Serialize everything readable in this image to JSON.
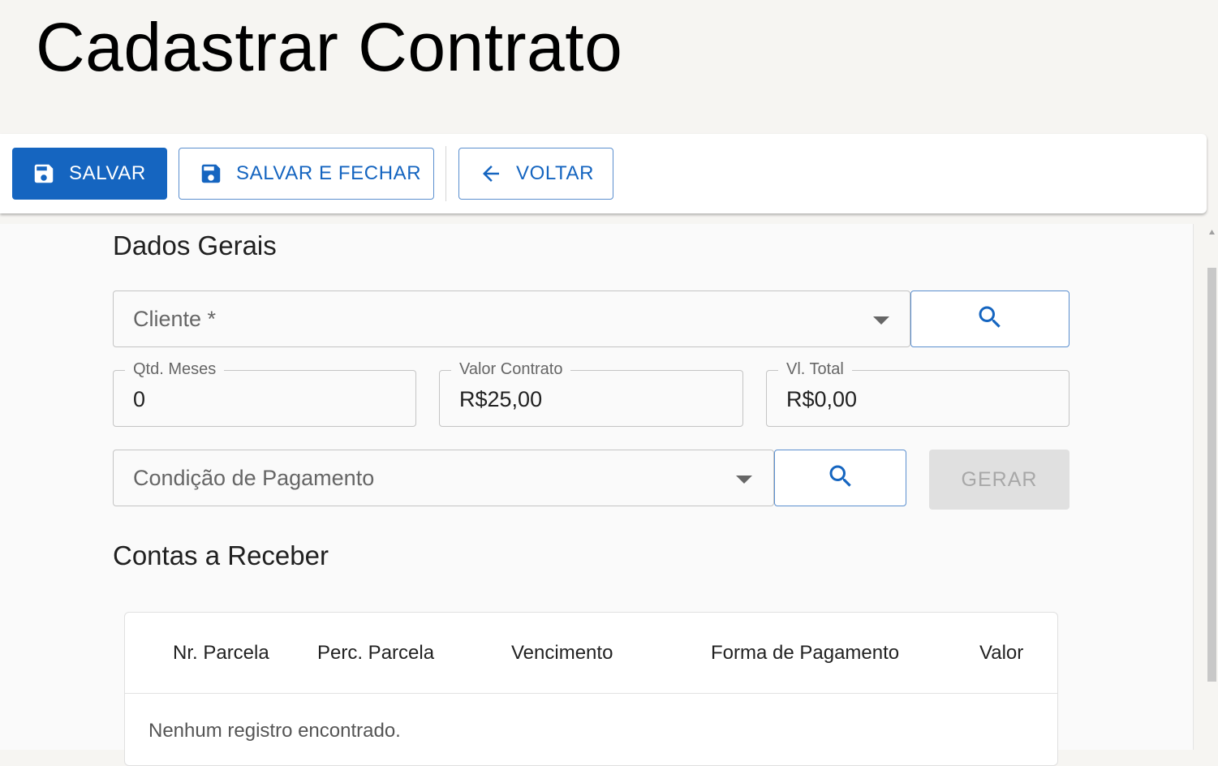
{
  "page": {
    "title": "Cadastrar Contrato"
  },
  "toolbar": {
    "save_label": "SALVAR",
    "save_close_label": "SALVAR E FECHAR",
    "back_label": "VOLTAR"
  },
  "general": {
    "title": "Dados Gerais",
    "cliente": {
      "placeholder": "Cliente *"
    },
    "qtd_meses": {
      "label": "Qtd. Meses",
      "value": "0"
    },
    "valor_contrato": {
      "label": "Valor Contrato",
      "value": "R$25,00"
    },
    "vl_total": {
      "label": "Vl. Total",
      "value": "R$0,00"
    },
    "condicao": {
      "placeholder": "Condição de Pagamento"
    },
    "gerar_label": "GERAR"
  },
  "receivables": {
    "title": "Contas a Receber",
    "columns": [
      "Nr. Parcela",
      "Perc. Parcela",
      "Vencimento",
      "Forma de Pagamento",
      "Valor"
    ],
    "empty_message": "Nenhum registro encontrado."
  },
  "colors": {
    "primary": "#1565c0",
    "background": "#f6f5f2",
    "disabled": "#e0e0e0"
  },
  "icons": [
    "save-icon",
    "arrow-left-icon",
    "search-icon",
    "chevron-down-icon"
  ]
}
